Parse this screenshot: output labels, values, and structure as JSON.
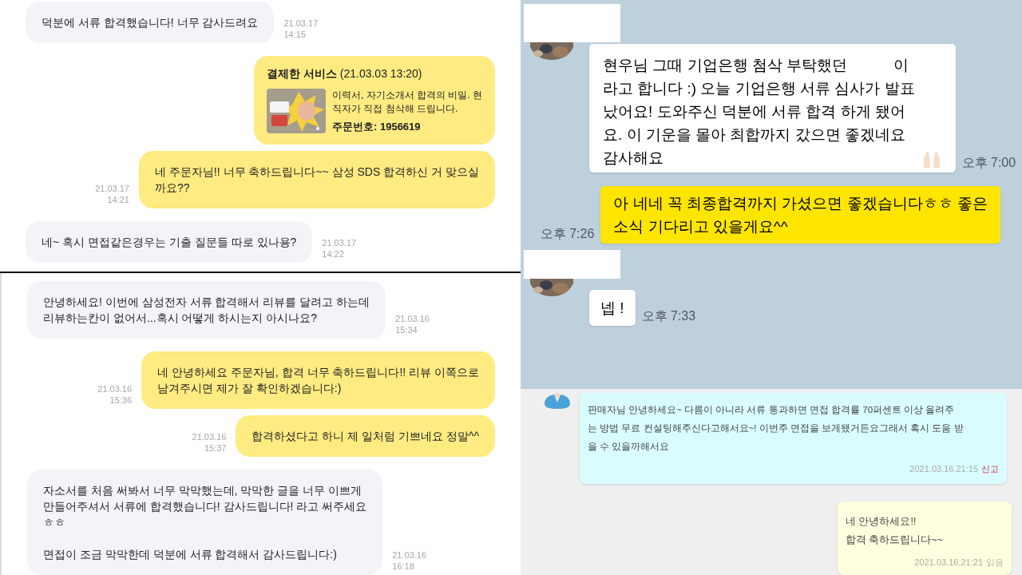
{
  "market_chat_1": {
    "messages": [
      {
        "outgoing": false,
        "kind": "text",
        "paragraphs": [
          [
            "덕분에 서류 합격했습니다! 너무 감사드려요"
          ]
        ],
        "date": "21.03.17",
        "time": "14:15"
      },
      {
        "outgoing": true,
        "kind": "order",
        "title": "**결제한 서비스** (21.03.03 13:20)",
        "paragraphs": [
          [
            "이력서, 자기소개서 합격의 비밀. 현",
            "직자가 직접 첨삭해 드립니다."
          ]
        ],
        "order": "주문번호: 1956619"
      },
      {
        "outgoing": true,
        "kind": "text",
        "paragraphs": [
          [
            "네 주문자님!! 너무 축하드립니다~~ 삼성 SDS 합격하신 거 맞으실",
            "까요??"
          ]
        ],
        "date": "21.03.17",
        "time": "14:21"
      },
      {
        "outgoing": false,
        "kind": "text",
        "paragraphs": [
          [
            "네~ 혹시 면접같은경우는 기출 질문들 따로 있나용?"
          ]
        ],
        "date": "21.03.17",
        "time": "14:22"
      }
    ]
  },
  "market_chat_2": {
    "messages": [
      {
        "outgoing": false,
        "kind": "text",
        "paragraphs": [
          [
            "안녕하세요! 이번에 삼성전자 서류 합격해서 리뷰를 달려고 하는데",
            "리뷰하는칸이 없어서...혹시 어떻게 하시는지 아시나요?"
          ]
        ],
        "date": "21.03.16",
        "time": "15:34"
      },
      {
        "outgoing": true,
        "kind": "text",
        "paragraphs": [
          [
            "네 안녕하세요 주문자님, 합격 너무 축하드립니다!! 리뷰 이쪽으로",
            "남겨주시면 제가 잘 확인하겠습니다:)"
          ]
        ],
        "date": "21.03.16",
        "time": "15:36"
      },
      {
        "outgoing": true,
        "kind": "text",
        "paragraphs": [
          [
            "합격하셨다고 하니 제 일처럼 기쁘네요 정말^^"
          ]
        ],
        "date": "21.03.16",
        "time": "15:37"
      },
      {
        "outgoing": false,
        "kind": "text",
        "paragraphs": [
          [
            "자소서를 처음 써봐서 너무 막막했는데, 막막한 글을 너무 이쁘게",
            "만들어주셔서 서류에 합격했습니다! 감사드립니다! 라고 써주세요",
            "ㅎㅎ"
          ],
          [
            "면접이 조금 막막한데 덕분에 서류 합격해서 감사드립니다:)"
          ]
        ],
        "date": "21.03.16",
        "time": "16:18"
      }
    ]
  },
  "messenger_chat": {
    "messages": [
      {
        "outgoing": false,
        "lines": [
          "현우님 그때 기업은행 첨삭 부탁했던           이",
          "라고 합니다 :) 오늘 기업은행 서류 심사가 발표",
          "났어요! 도와주신 덕분에 서류 합격 하게 됐어",
          "요. 이 기운을 몰아 최합까지 갔으면 좋겠네요",
          "감사해요"
        ],
        "has_emoji": true,
        "time": "오후 7:00"
      },
      {
        "outgoing": true,
        "lines": [
          "아 네네 꼭 최종합격까지 가셨으면 좋겠습니다ㅎㅎ 좋은",
          "소식 기다리고 있을게요^^"
        ],
        "time": "오후 7:26"
      },
      {
        "outgoing": false,
        "lines": [
          "넵 !"
        ],
        "time": "오후 7:33"
      }
    ]
  },
  "web_chat": {
    "messages": [
      {
        "outgoing": false,
        "lines": [
          "판매자님 안녕하세요~ 다름이 아니라 서류 통과하면 면접 합격률 70퍼센트 이상 올려주",
          "는 방법 무료 컨설팅해주신다고해서요~! 이번주 면접을 보게됐거든요그래서 혹시 도움 받",
          "을 수 있을까해서요"
        ],
        "timestamp": "2021.03.16.21:15",
        "action": "신고"
      },
      {
        "outgoing": true,
        "lines": [
          "네 안녕하세요!!",
          "합격 축하드립니다~~"
        ],
        "timestamp": "2021.03.16.21:21",
        "status": "읽음"
      }
    ]
  }
}
